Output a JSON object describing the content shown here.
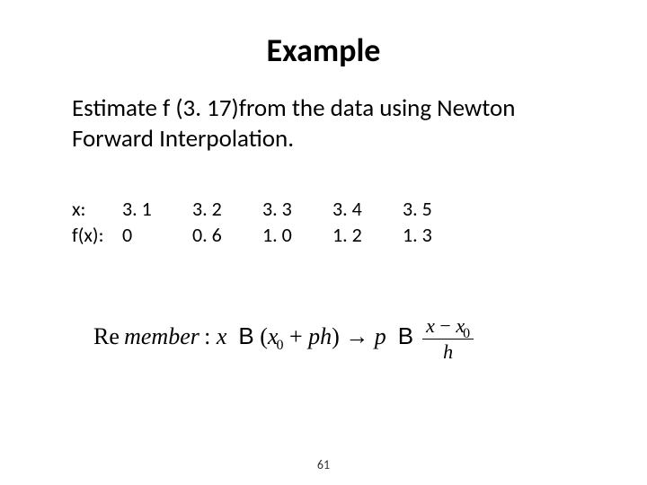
{
  "title": "Example",
  "body": "Estimate f (3. 17)from the data using Newton Forward Interpolation.",
  "table": {
    "row_x_label": "x:",
    "row_fx_label": "f(x):",
    "x": [
      "3. 1",
      "3. 2",
      "3. 3",
      "3. 4",
      "3. 5"
    ],
    "fx": [
      "0",
      "0. 6",
      "1. 0",
      "1. 2",
      "1. 3"
    ]
  },
  "formula": {
    "prefix1": "Re",
    "prefix2": "member",
    "colon": ":",
    "lhs_x": "x",
    "op": "B",
    "open": "(",
    "x0": "x",
    "x0_sub": "0",
    "plus": "+",
    "ph": "ph",
    "close": ")",
    "arrow": "→",
    "p": "p",
    "op2": "B",
    "frac_num_a": "x",
    "frac_num_minus": "−",
    "frac_num_b": "x",
    "frac_num_b_sub": "0",
    "frac_den": "h"
  },
  "page_number": "61"
}
